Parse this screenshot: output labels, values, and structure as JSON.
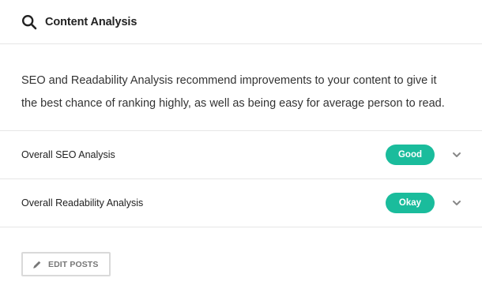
{
  "header": {
    "title": "Content Analysis",
    "icon": "search-icon"
  },
  "description": "SEO and Readability Analysis recommend improvements to your content to give it the best chance of ranking highly, as well as being easy for average person to read.",
  "analyses": [
    {
      "label": "Overall SEO Analysis",
      "status": "Good",
      "status_color": "#1abc9c",
      "icon": "chevron-down-icon"
    },
    {
      "label": "Overall Readability Analysis",
      "status": "Okay",
      "status_color": "#1abc9c",
      "icon": "chevron-down-icon"
    }
  ],
  "footer": {
    "edit_button_label": "EDIT POSTS",
    "edit_button_icon": "pencil-icon"
  },
  "colors": {
    "accent": "#1abc9c",
    "border": "#e6e6e6",
    "text": "#333333"
  }
}
